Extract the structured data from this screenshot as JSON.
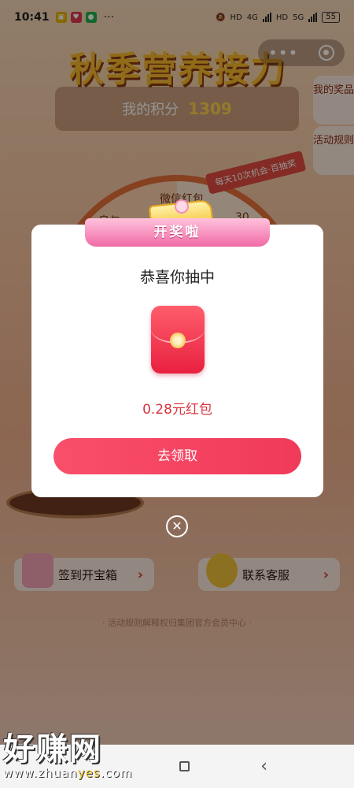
{
  "status_bar": {
    "time": "10:41",
    "net1": "4G",
    "net2": "5G",
    "hd1": "HD",
    "hd2": "HD",
    "battery": "55"
  },
  "header": {
    "title": "秋季营养接力",
    "points_label": "我的积分",
    "points_value": "1309"
  },
  "side_buttons": [
    {
      "label": "我的奖品"
    },
    {
      "label": "活动规则"
    }
  ],
  "wheel": {
    "ribbon": "每天10次机会·百抽奖",
    "segments": [
      "微信红包",
      "30",
      "良与"
    ]
  },
  "bottom_buttons": [
    {
      "label": "签到开宝箱"
    },
    {
      "label": "联系客服"
    }
  ],
  "footer_note": "· 活动规则解释权归集团官方会员中心 ·",
  "modal": {
    "tab_label": "开奖啦",
    "title": "恭喜你抽中",
    "prize": "0.28元红包",
    "claim_label": "去领取",
    "close_glyph": "✕"
  },
  "watermark": {
    "main": "好赚网",
    "url_prefix": "www.zhuan",
    "url_highlight": "yes",
    "url_suffix": ".com"
  },
  "nav": {
    "back_glyph": "‹"
  }
}
